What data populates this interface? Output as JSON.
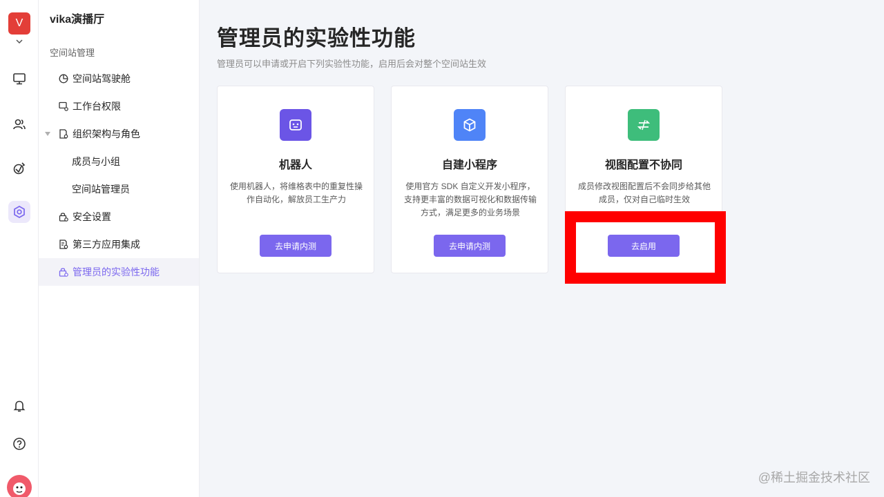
{
  "rail": {
    "space_avatar_letter": "V",
    "icons": [
      "chevron-down-icon",
      "workbench-icon",
      "contacts-icon",
      "template-icon",
      "space-management-icon",
      "notification-bell-icon",
      "help-icon"
    ]
  },
  "sidebar": {
    "space_name": "vika演播厅",
    "section_title": "空间站管理",
    "items": [
      {
        "label": "空间站驾驶舱",
        "icon": "pie-chart-icon"
      },
      {
        "label": "工作台权限",
        "icon": "workbench-permission-icon"
      },
      {
        "label": "组织架构与角色",
        "icon": "org-structure-icon"
      },
      {
        "label": "成员与小组"
      },
      {
        "label": "空间站管理员"
      },
      {
        "label": "安全设置",
        "icon": "security-lock-icon"
      },
      {
        "label": "第三方应用集成",
        "icon": "integration-icon"
      },
      {
        "label": "管理员的实验性功能",
        "icon": "lab-icon",
        "active": true
      }
    ]
  },
  "main": {
    "title": "管理员的实验性功能",
    "subtitle": "管理员可以申请或开启下列实验性功能，启用后会对整个空间站生效",
    "cards": [
      {
        "title": "机器人",
        "desc": "使用机器人，将维格表中的重复性操作自动化，解放员工生产力",
        "button": "去申请内测",
        "icon": "robot-icon",
        "icon_color": "#6b55e6"
      },
      {
        "title": "自建小程序",
        "desc": "使用官方 SDK 自定义开发小程序，支持更丰富的数据可视化和数据传输方式，满足更多的业务场景",
        "button": "去申请内测",
        "icon": "cube-icon",
        "icon_color": "#4f84f7"
      },
      {
        "title": "视图配置不协同",
        "desc": "成员修改视图配置后不会同步给其他成员，仅对自己临时生效",
        "button": "去启用",
        "icon": "swap-arrows-icon",
        "icon_color": "#3ebd7b"
      }
    ]
  },
  "watermark": "@稀土掘金技术社区",
  "colors": {
    "accent": "#7b67ee",
    "highlight": "#ff0000"
  }
}
